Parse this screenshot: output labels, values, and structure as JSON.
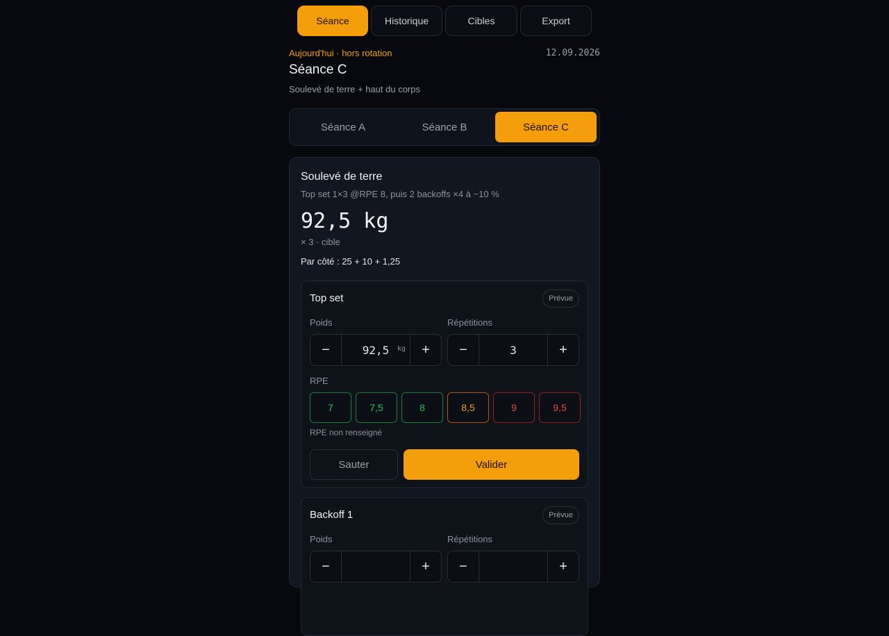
{
  "nav": {
    "tabs": [
      {
        "label": "Séance",
        "active": true
      },
      {
        "label": "Historique",
        "active": false
      },
      {
        "label": "Cibles",
        "active": false
      },
      {
        "label": "Export",
        "active": false
      }
    ]
  },
  "header": {
    "today": "Aujourd'hui · hors rotation",
    "date": "12.09.2026",
    "title": "Séance C",
    "description": "Soulevé de terre + haut du corps"
  },
  "session_tabs": [
    {
      "label": "Séance A",
      "active": false
    },
    {
      "label": "Séance B",
      "active": false
    },
    {
      "label": "Séance C",
      "active": true
    }
  ],
  "exercise": {
    "name": "Soulevé de terre",
    "scheme": "Top set 1×3 @RPE 8, puis 2 backoffs ×4 à −10 %",
    "weight": "92,5 kg",
    "reps_target": "× 3 · cible",
    "plates": "Par côté : 25 + 10 + 1,25",
    "sets": [
      {
        "title": "Top set",
        "status": "Prévue",
        "weight_label": "Poids",
        "weight_value": "92,5",
        "weight_unit": "kg",
        "reps_label": "Répétitions",
        "reps_value": "3",
        "rpe_label": "RPE",
        "rpe_options": [
          "7",
          "7,5",
          "8",
          "8,5",
          "9",
          "9,5"
        ],
        "rpe_note": "RPE non renseigné",
        "skip_label": "Sauter",
        "validate_label": "Valider"
      },
      {
        "title": "Backoff 1",
        "status": "Prévue",
        "weight_label": "Poids",
        "reps_label": "Répétitions"
      }
    ]
  },
  "icons": {
    "minus": "−",
    "plus": "+"
  },
  "colors": {
    "accent": "#f59e0b",
    "rpe_low": "#22c55e",
    "rpe_mid": "#f59e0b",
    "rpe_high": "#ef4444"
  }
}
